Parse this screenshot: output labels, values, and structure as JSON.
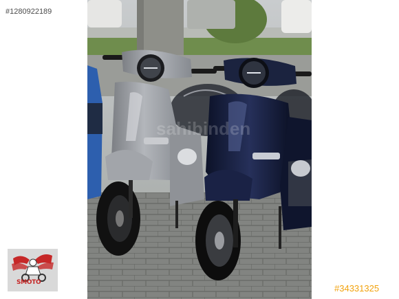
{
  "image_id_text": "#1280922189",
  "listing_id_text": "#34331325",
  "watermark": "sahibinden",
  "logo": {
    "text": "SMOTO"
  },
  "colors": {
    "listing_id": "#f2a20c",
    "logo_red": "#c62828",
    "scooter_grey": "#9b9ea3",
    "scooter_navy": "#141c38"
  }
}
